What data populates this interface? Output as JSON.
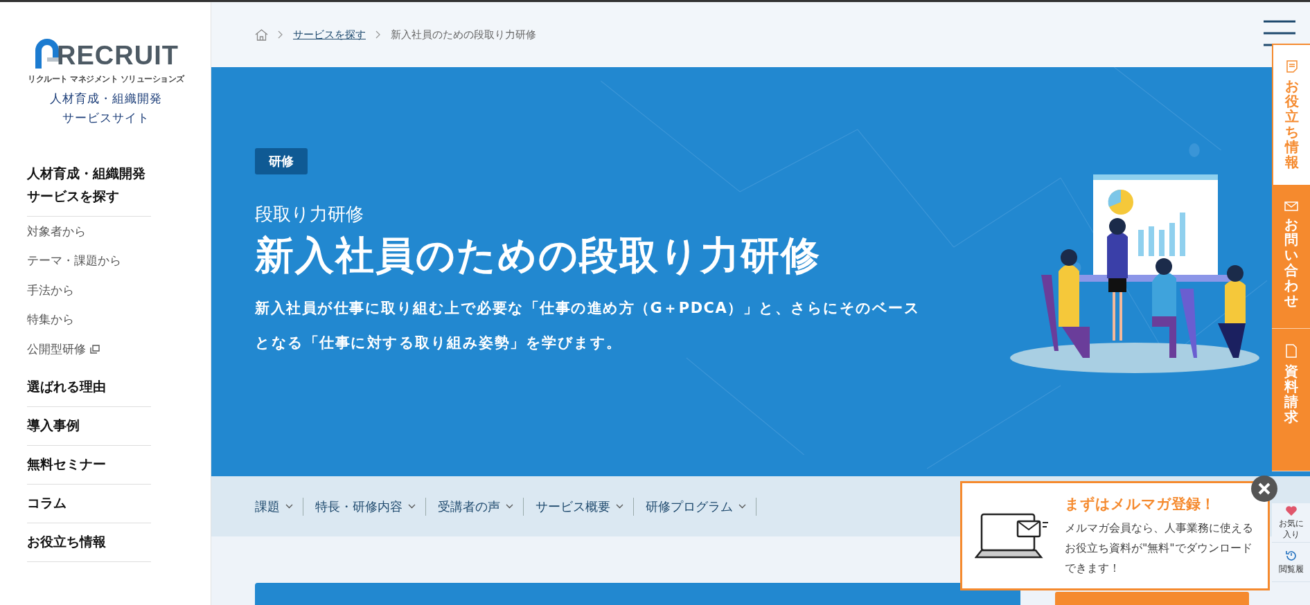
{
  "sidebar": {
    "logo": {
      "wordmark": "RECRUIT",
      "tagline": "リクルート マネジメント ソリューションズ"
    },
    "site_title": "人材育成・組織開発サービスサイト",
    "nav": [
      {
        "kind": "section",
        "label": "人材育成・組織開発サービスを探す"
      },
      {
        "kind": "sub",
        "label": "対象者から",
        "external": false
      },
      {
        "kind": "sub",
        "label": "テーマ・課題から",
        "external": false
      },
      {
        "kind": "sub",
        "label": "手法から",
        "external": false
      },
      {
        "kind": "sub",
        "label": "特集から",
        "external": false
      },
      {
        "kind": "sub",
        "label": "公開型研修",
        "external": true
      },
      {
        "kind": "section",
        "label": "選ばれる理由"
      },
      {
        "kind": "section",
        "label": "導入事例"
      },
      {
        "kind": "section",
        "label": "無料セミナー"
      },
      {
        "kind": "section",
        "label": "コラム"
      },
      {
        "kind": "section",
        "label": "お役立ち情報"
      }
    ]
  },
  "breadcrumb": [
    {
      "kind": "home"
    },
    {
      "kind": "link",
      "label": "サービスを探す"
    },
    {
      "kind": "current",
      "label": "新入社員のための段取り力研修"
    }
  ],
  "hero": {
    "tag": "研修",
    "subtitle": "段取り力研修",
    "title": "新入社員のための段取り力研修",
    "description": "新入社員が仕事に取り組む上で必要な「仕事の進め方（G＋PDCA）」と、さらにそのベースとなる「仕事に対する取り組み姿勢」を学びます。"
  },
  "page_tabs": [
    "課題",
    "特長・研修内容",
    "受講者の声",
    "サービス概要",
    "研修プログラム"
  ],
  "side_tabs": [
    {
      "kind": "info",
      "label": "お役立ち情報",
      "selected": true
    },
    {
      "kind": "contact",
      "label": "お問い合わせ",
      "selected": false
    },
    {
      "kind": "document",
      "label": "資料請求",
      "selected": false
    }
  ],
  "utility": [
    {
      "kind": "favorite",
      "label": "お気に入り"
    },
    {
      "kind": "history",
      "label": "閲覧履"
    }
  ],
  "popup": {
    "title": "まずはメルマガ登録！",
    "body": "メルマガ会員なら、人事業務に使えるお役立ち資料が\"無料\"でダウンロードできます！"
  }
}
